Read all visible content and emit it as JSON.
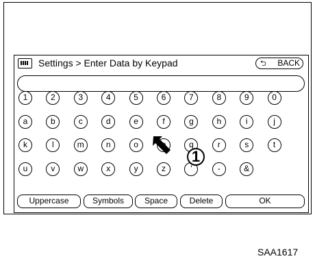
{
  "header": {
    "title": "Settings > Enter Data by Keypad",
    "back_label": "BACK",
    "keyboard_icon": "keyboard-icon",
    "back_icon": "return-arrow-icon"
  },
  "input": {
    "value": ""
  },
  "keys": [
    [
      "1",
      "2",
      "3",
      "4",
      "5",
      "6",
      "7",
      "8",
      "9",
      "0"
    ],
    [
      "a",
      "b",
      "c",
      "d",
      "e",
      "f",
      "g",
      "h",
      "i",
      "j"
    ],
    [
      "k",
      "l",
      "m",
      "n",
      "o",
      "p",
      "q",
      "r",
      "s",
      "t"
    ],
    [
      "u",
      "v",
      "w",
      "x",
      "y",
      "z",
      "'",
      "-",
      "&"
    ]
  ],
  "bottom": {
    "uppercase": "Uppercase",
    "symbols": "Symbols",
    "space": "Space",
    "delete": "Delete",
    "ok": "OK"
  },
  "callout": "1",
  "figure_code": "SAA1617"
}
